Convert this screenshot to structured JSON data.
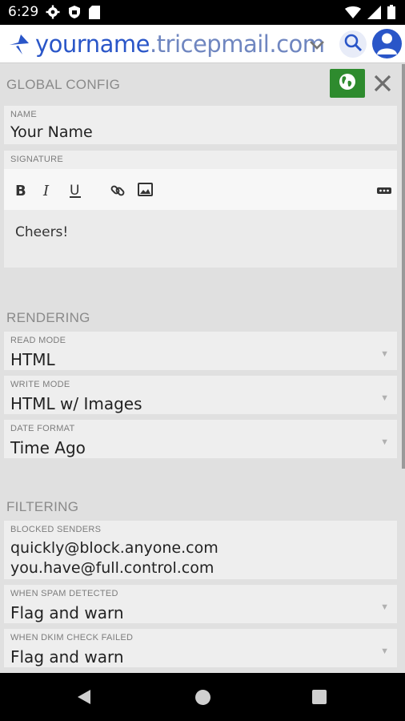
{
  "status_bar": {
    "time": "6:29",
    "icons_left": [
      "gear-icon",
      "shield-icon",
      "sd-card-icon"
    ],
    "icons_right": [
      "wifi-icon",
      "signal-icon",
      "battery-icon"
    ]
  },
  "app_bar": {
    "title_user": "yourname",
    "title_domain": ".tricepmail.com"
  },
  "global_config": {
    "title": "GLOBAL CONFIG",
    "name": {
      "label": "NAME",
      "value": "Your Name"
    },
    "signature": {
      "label": "SIGNATURE",
      "toolbar": [
        "bold-icon",
        "italic-icon",
        "underline-icon",
        "link-icon",
        "image-icon",
        "more-icon"
      ],
      "text": "Cheers!"
    }
  },
  "rendering": {
    "title": "RENDERING",
    "read_mode": {
      "label": "READ MODE",
      "value": "HTML"
    },
    "write_mode": {
      "label": "WRITE MODE",
      "value": "HTML w/ Images"
    },
    "date_format": {
      "label": "DATE FORMAT",
      "value": "Time Ago"
    }
  },
  "filtering": {
    "title": "FILTERING",
    "blocked_senders": {
      "label": "BLOCKED SENDERS",
      "values": [
        "quickly@block.anyone.com",
        "you.have@full.control.com"
      ]
    },
    "spam": {
      "label": "WHEN SPAM DETECTED",
      "value": "Flag and warn"
    },
    "dkim": {
      "label": "WHEN DKIM CHECK FAILED",
      "value": "Flag and warn"
    }
  },
  "colors": {
    "brand_blue": "#2a56c8",
    "globe_green": "#2e8b2e"
  }
}
